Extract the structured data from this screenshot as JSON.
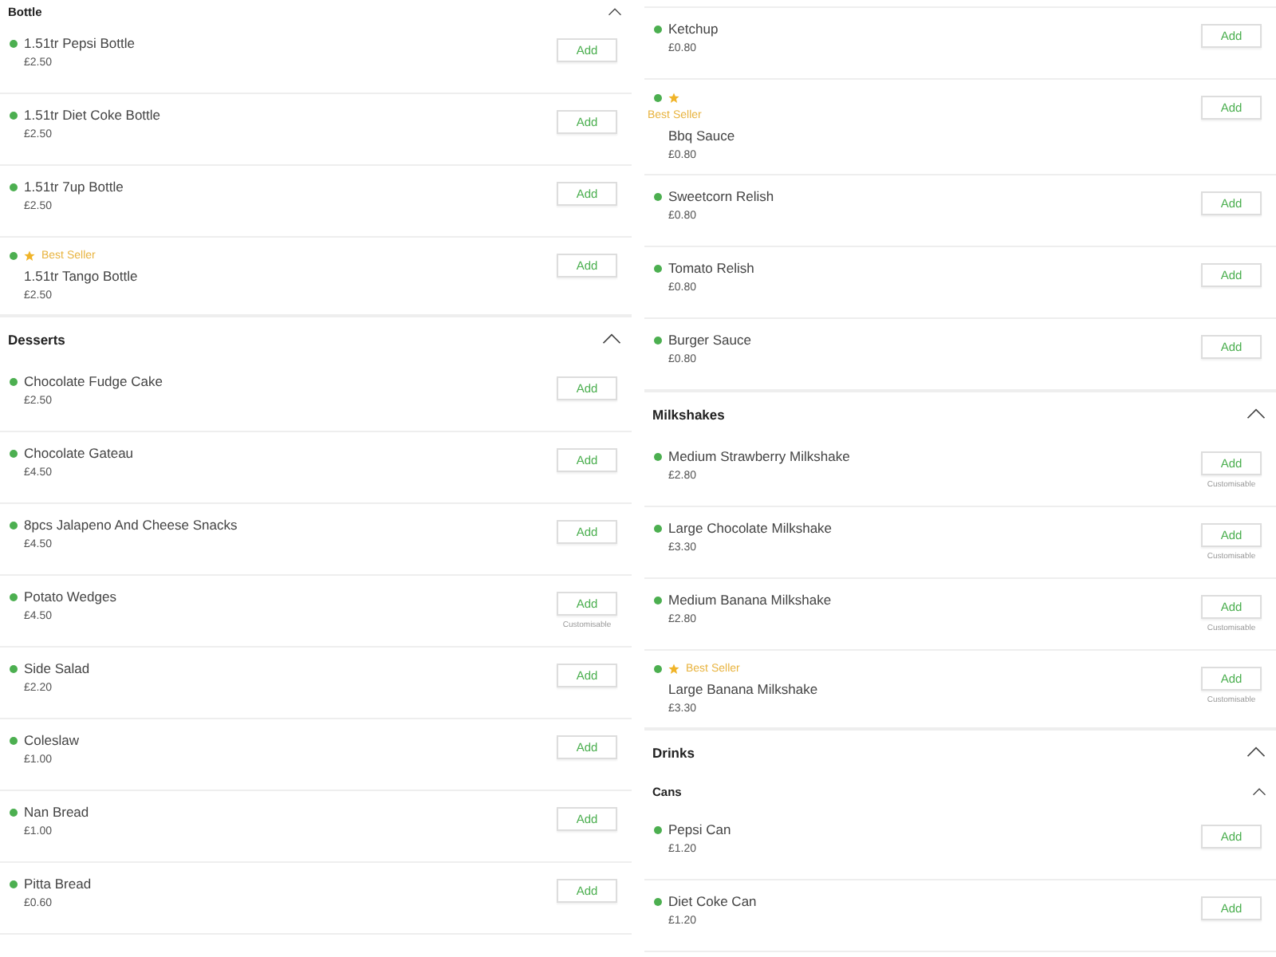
{
  "columns": [
    {
      "blocks": [
        {
          "kind": "subsection",
          "title": "Bottle",
          "expanded": true
        },
        {
          "kind": "item",
          "name": "1.51tr Pepsi Bottle",
          "price": "£2.50",
          "button": "Add"
        },
        {
          "kind": "item",
          "name": "1.51tr Diet Coke Bottle",
          "price": "£2.50",
          "button": "Add"
        },
        {
          "kind": "item",
          "name": "1.51tr 7up Bottle",
          "price": "£2.50",
          "button": "Add"
        },
        {
          "kind": "item",
          "name": "1.51tr Tango Bottle",
          "price": "£2.50",
          "button": "Add",
          "badge": "Best Seller",
          "badge_wrapped": false
        },
        {
          "kind": "section",
          "title": "Desserts",
          "expanded": true
        },
        {
          "kind": "item",
          "name": "Chocolate Fudge Cake",
          "price": "£2.50",
          "button": "Add"
        },
        {
          "kind": "item",
          "name": "Chocolate Gateau",
          "price": "£4.50",
          "button": "Add"
        },
        {
          "kind": "item",
          "name": "8pcs Jalapeno And Cheese Snacks",
          "price": "£4.50",
          "button": "Add"
        },
        {
          "kind": "item",
          "name": "Potato Wedges",
          "price": "£4.50",
          "button": "Add",
          "note": "Customisable"
        },
        {
          "kind": "item",
          "name": "Side Salad",
          "price": "£2.20",
          "button": "Add"
        },
        {
          "kind": "item",
          "name": "Coleslaw",
          "price": "£1.00",
          "button": "Add"
        },
        {
          "kind": "item",
          "name": "Nan Bread",
          "price": "£1.00",
          "button": "Add"
        },
        {
          "kind": "item",
          "name": "Pitta Bread",
          "price": "£0.60",
          "button": "Add"
        }
      ]
    },
    {
      "blocks": [
        {
          "kind": "item",
          "name": "Ketchup",
          "price": "£0.80",
          "button": "Add"
        },
        {
          "kind": "item",
          "name": "Bbq Sauce",
          "price": "£0.80",
          "button": "Add",
          "badge": "Best Seller",
          "badge_wrapped": true
        },
        {
          "kind": "item",
          "name": "Sweetcorn Relish",
          "price": "£0.80",
          "button": "Add"
        },
        {
          "kind": "item",
          "name": "Tomato Relish",
          "price": "£0.80",
          "button": "Add"
        },
        {
          "kind": "item",
          "name": "Burger Sauce",
          "price": "£0.80",
          "button": "Add"
        },
        {
          "kind": "section",
          "title": "Milkshakes",
          "expanded": true
        },
        {
          "kind": "item",
          "name": "Medium Strawberry Milkshake",
          "price": "£2.80",
          "button": "Add",
          "note": "Customisable"
        },
        {
          "kind": "item",
          "name": "Large Chocolate Milkshake",
          "price": "£3.30",
          "button": "Add",
          "note": "Customisable"
        },
        {
          "kind": "item",
          "name": "Medium Banana Milkshake",
          "price": "£2.80",
          "button": "Add",
          "note": "Customisable"
        },
        {
          "kind": "item",
          "name": "Large Banana Milkshake",
          "price": "£3.30",
          "button": "Add",
          "note": "Customisable",
          "badge": "Best Seller",
          "badge_wrapped": false
        },
        {
          "kind": "section",
          "title": "Drinks",
          "expanded": true
        },
        {
          "kind": "subsection",
          "title": "Cans",
          "expanded": true
        },
        {
          "kind": "item",
          "name": "Pepsi Can",
          "price": "£1.20",
          "button": "Add"
        },
        {
          "kind": "item",
          "name": "Diet Coke Can",
          "price": "£1.20",
          "button": "Add"
        }
      ]
    }
  ]
}
